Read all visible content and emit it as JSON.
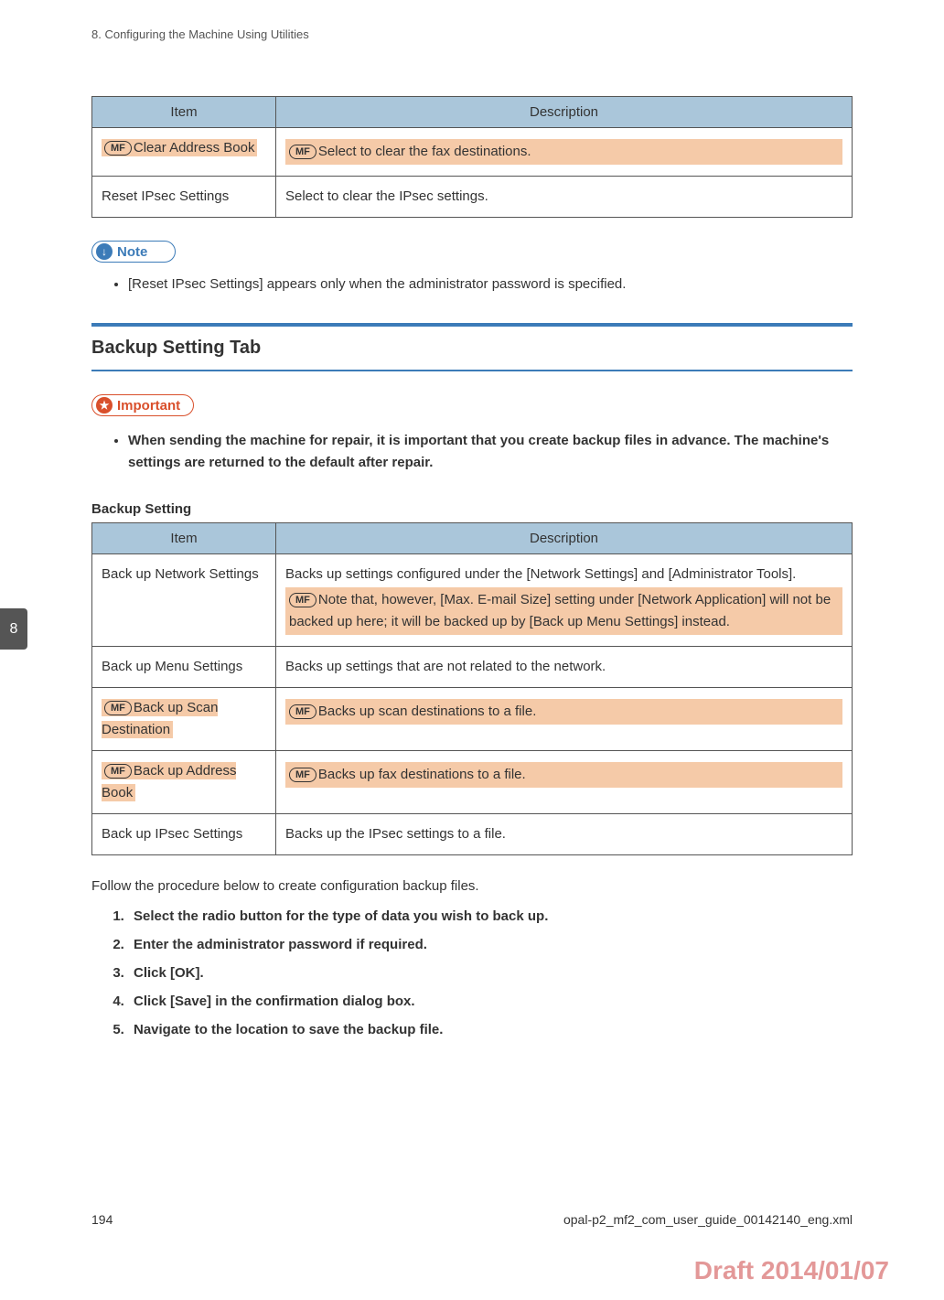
{
  "header": "8. Configuring the Machine Using Utilities",
  "chapter_tab": "8",
  "table1": {
    "headers": [
      "Item",
      "Description"
    ],
    "rows": [
      {
        "item_mf": true,
        "item": "Clear Address Book",
        "desc_mf": true,
        "desc": "Select to clear the fax destinations."
      },
      {
        "item_mf": false,
        "item": "Reset IPsec Settings",
        "desc_mf": false,
        "desc": "Select to clear the IPsec settings."
      }
    ]
  },
  "mf_label": "MF",
  "note": {
    "label": "Note",
    "items": [
      "[Reset IPsec Settings] appears only when the administrator password is specified."
    ]
  },
  "section_heading": "Backup Setting Tab",
  "important": {
    "label": "Important",
    "items": [
      "When sending the machine for repair, it is important that you create backup files in advance. The machine's settings are returned to the default after repair."
    ]
  },
  "sub_heading": "Backup Setting",
  "table2": {
    "headers": [
      "Item",
      "Description"
    ],
    "rows": [
      {
        "item_mf": false,
        "item": "Back up Network Settings",
        "desc_plain": "Backs up settings configured under the [Network Settings] and [Administrator Tools].",
        "desc_mf": "Note that, however, [Max. E-mail Size] setting under [Network Application] will not be backed up here; it will be backed up by [Back up Menu Settings] instead."
      },
      {
        "item_mf": false,
        "item": "Back up Menu Settings",
        "desc_plain": "Backs up settings that are not related to the network."
      },
      {
        "item_mf": true,
        "item": "Back up Scan Destination",
        "desc_mf_only": "Backs up scan destinations to a file."
      },
      {
        "item_mf": true,
        "item": "Back up Address Book",
        "desc_mf_only": "Backs up fax destinations to a file."
      },
      {
        "item_mf": false,
        "item": "Back up IPsec Settings",
        "desc_plain": "Backs up the IPsec settings to a file."
      }
    ]
  },
  "body_text": "Follow the procedure below to create configuration backup files.",
  "steps": [
    "Select the radio button for the type of data you wish to back up.",
    "Enter the administrator password if required.",
    "Click [OK].",
    "Click [Save] in the confirmation dialog box.",
    "Navigate to the location to save the backup file."
  ],
  "footer": {
    "page_number": "194",
    "filename": "opal-p2_mf2_com_user_guide_00142140_eng.xml"
  },
  "draft_mark": "Draft 2014/01/07"
}
